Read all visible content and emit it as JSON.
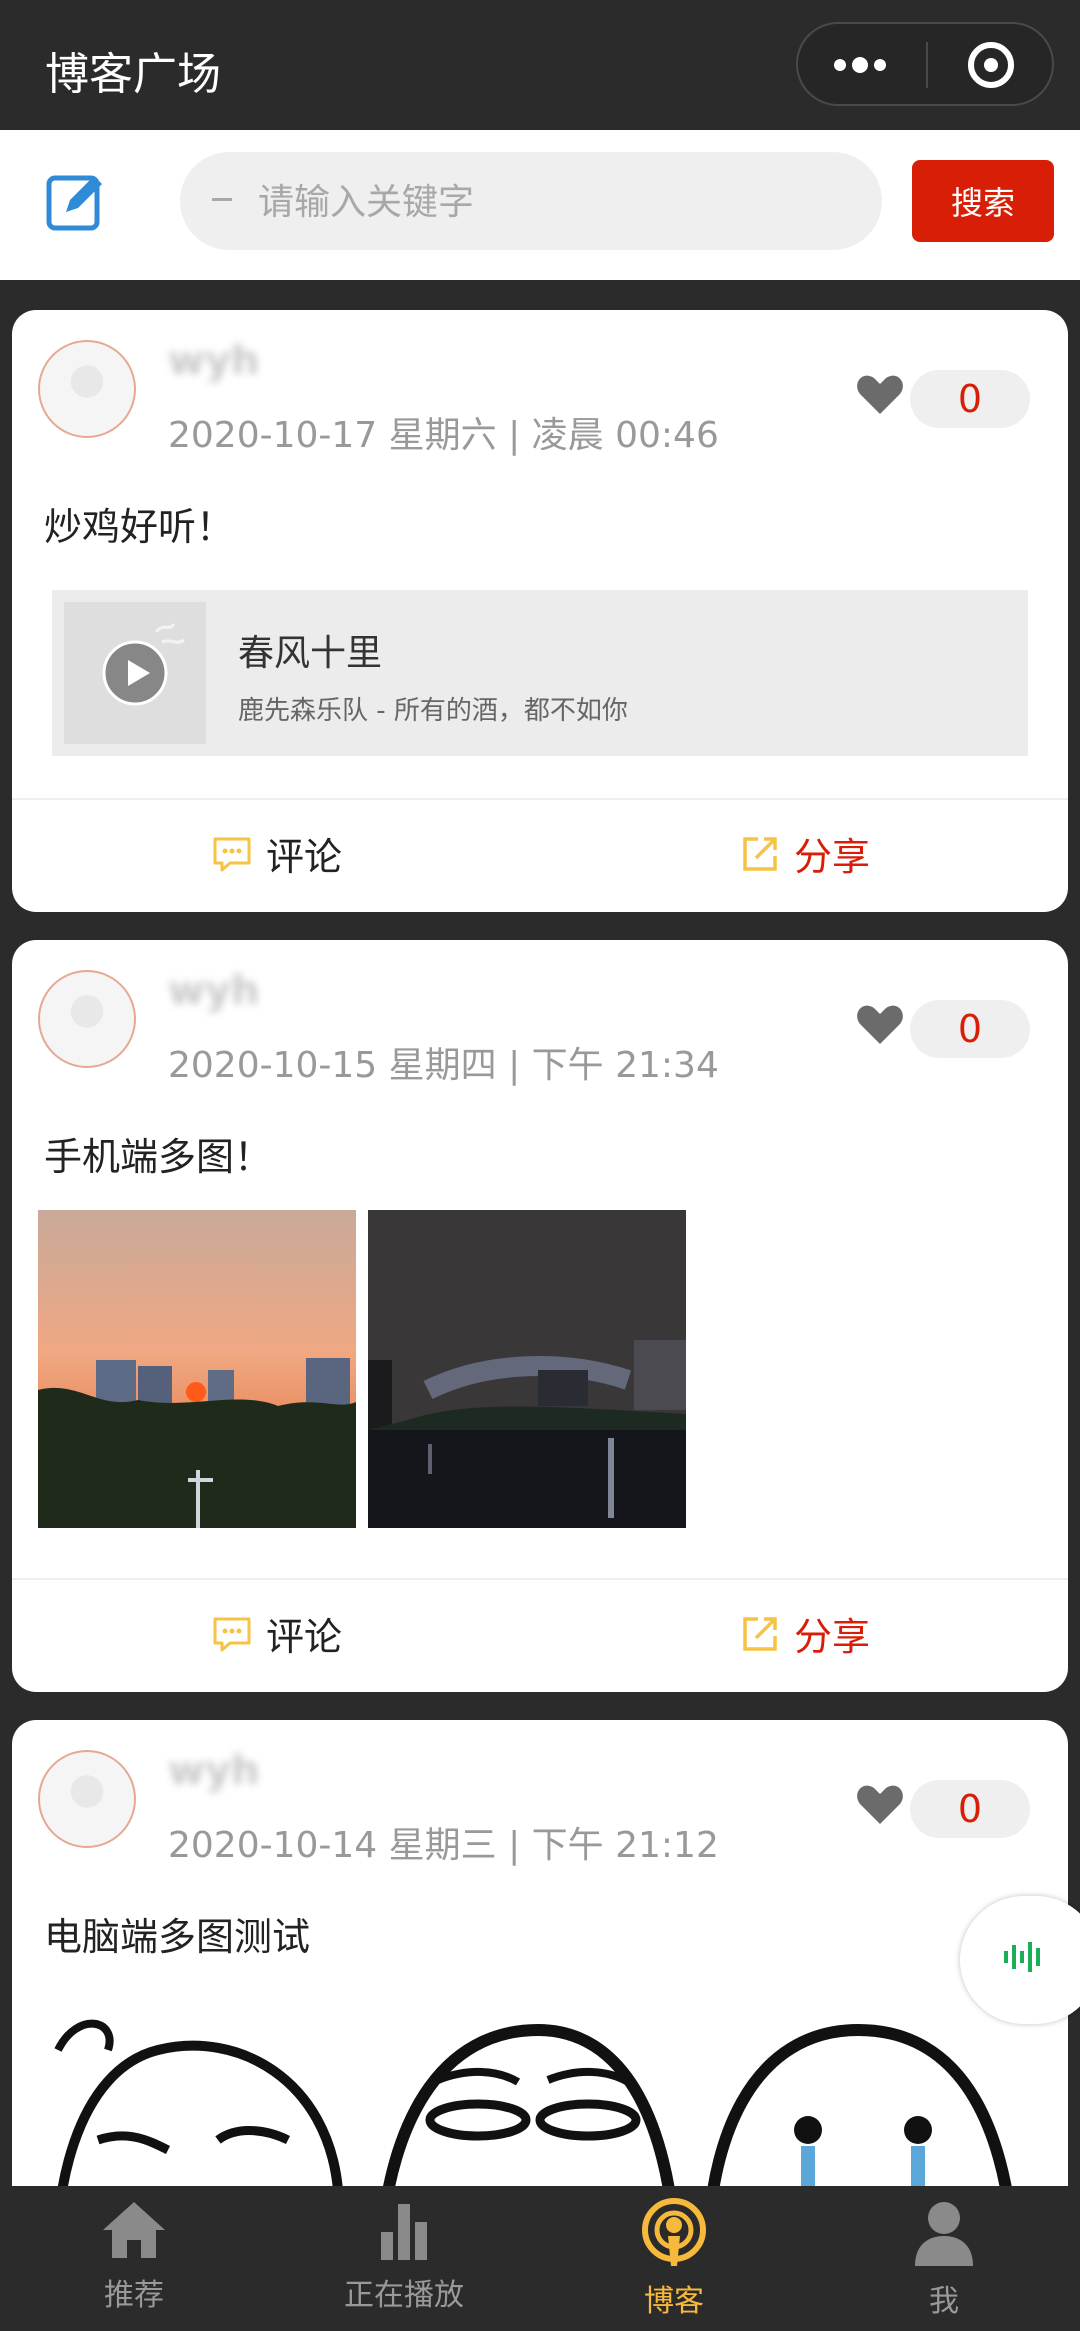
{
  "header": {
    "title": "博客广场"
  },
  "search": {
    "placeholder": "请输入关键字",
    "value": "",
    "button_label": "搜索"
  },
  "posts": [
    {
      "username": "wyh",
      "timestamp": "2020-10-17 星期六 | 凌晨 00:46",
      "like_count": "0",
      "text": "炒鸡好听！",
      "music": {
        "title": "春风十里",
        "artist": "鹿先森乐队 - 所有的酒，都不如你"
      },
      "comment_label": "评论",
      "share_label": "分享"
    },
    {
      "username": "wyh",
      "timestamp": "2020-10-15 星期四 | 下午 21:34",
      "like_count": "0",
      "text": "手机端多图！",
      "images": [
        "sunset-city-photo",
        "night-lake-photo"
      ],
      "comment_label": "评论",
      "share_label": "分享"
    },
    {
      "username": "wyh",
      "timestamp": "2020-10-14 星期三 | 下午 21:12",
      "like_count": "0",
      "text": "电脑端多图测试",
      "images": [
        "cartoon-face-sad",
        "cartoon-face-squint",
        "cartoon-face-crying"
      ]
    }
  ],
  "tabbar": {
    "items": [
      {
        "label": "推荐",
        "icon": "home-icon"
      },
      {
        "label": "正在播放",
        "icon": "bar-chart-icon"
      },
      {
        "label": "博客",
        "icon": "podcast-icon",
        "active": true
      },
      {
        "label": "我",
        "icon": "person-icon"
      }
    ]
  },
  "colors": {
    "accent_red": "#d81e06",
    "tab_active": "#f6b93b",
    "icon_yellow": "#f6c343",
    "dark_bg": "#2b2b2b",
    "music_green": "#1aad5a"
  }
}
